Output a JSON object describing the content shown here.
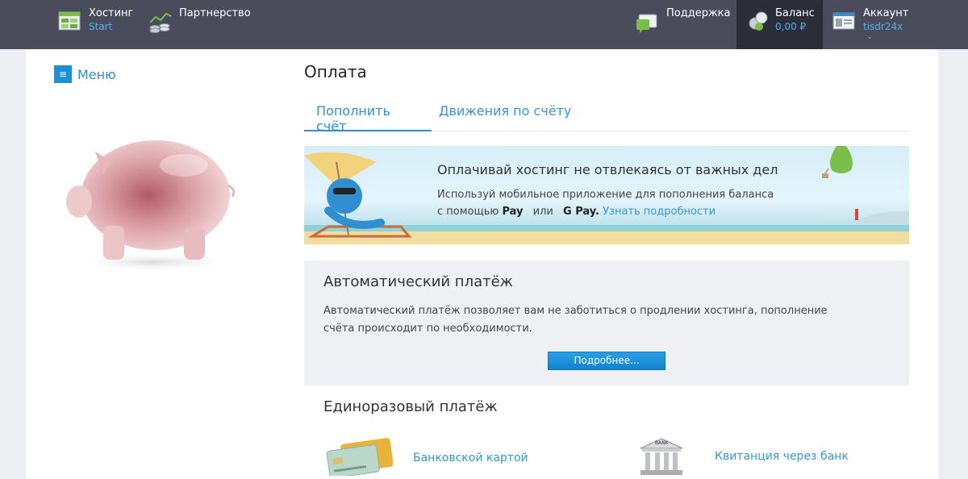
{
  "topbar": {
    "hosting": {
      "label": "Хостинг",
      "sub": "Start",
      "icon": "hosting-icon"
    },
    "partnership": {
      "label": "Партнерство",
      "icon": "partnership-icon"
    },
    "support": {
      "label": "Поддержка",
      "icon": "support-chat-icon"
    },
    "balance": {
      "label": "Баланс",
      "value": "0,00 ₽",
      "icon": "coins-icon"
    },
    "account": {
      "label": "Аккаунт",
      "user": "tisdr24x",
      "icon": "account-card-icon"
    }
  },
  "sidebar": {
    "menu_label": "Меню"
  },
  "page": {
    "title": "Оплата"
  },
  "tabs": [
    {
      "label": "Пополнить счёт",
      "active": true
    },
    {
      "label": "Движения по счёту",
      "active": false
    }
  ],
  "banner": {
    "title": "Оплачивай хостинг не отвлекаясь от важных дел",
    "text_line1": "Используй мобильное приложение для пополнения баланса",
    "text_with": "с помощью",
    "apple_pay": "Pay",
    "or": "или",
    "google_pay": "G Pay.",
    "link": "Узнать подробности"
  },
  "auto_payment": {
    "title": "Автоматический платёж",
    "text": "Автоматический платёж позволяет вам не заботиться о продлении хостинга, пополнение счёта происходит по необходимости.",
    "button": "Подробнее..."
  },
  "one_time_payment": {
    "title": "Единоразовый платёж",
    "options": [
      {
        "label": "Банковской картой",
        "icon": "bank-cards-icon"
      },
      {
        "label": "Квитанция через банк",
        "icon": "bank-building-icon",
        "icon_text": "BANK"
      }
    ]
  },
  "colors": {
    "topbar": "#4a4c5c",
    "accent": "#2f8fd0",
    "link": "#3696d2"
  }
}
